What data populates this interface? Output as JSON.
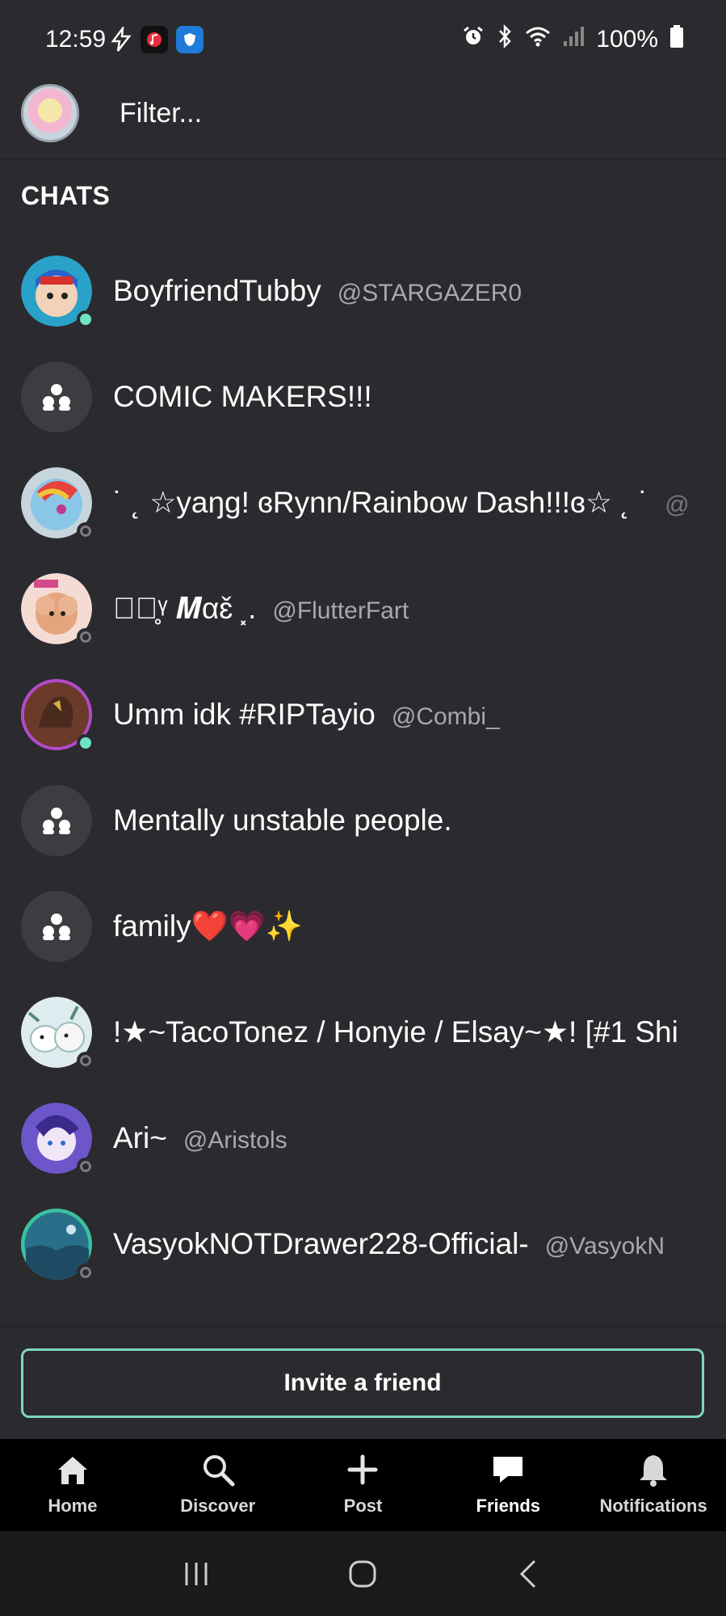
{
  "status_bar": {
    "time": "12:59",
    "battery": "100%",
    "app_icons": [
      "bolt-icon",
      "music-app-icon",
      "shield-app-icon"
    ],
    "system_icons": [
      "alarm-icon",
      "bluetooth-icon",
      "wifi-icon",
      "signal-icon",
      "battery-icon"
    ]
  },
  "header": {
    "filter_placeholder": "Filter..."
  },
  "chats": {
    "section_title": "CHATS",
    "items": [
      {
        "name": "BoyfriendTubby",
        "handle": "@STARGAZER0",
        "type": "user",
        "status": "online",
        "avatar_color": "#2aa1c9"
      },
      {
        "name": "COMIC MAKERS!!!",
        "handle": "",
        "type": "group",
        "status": "",
        "avatar_color": "#3d3c41"
      },
      {
        "name": "˙ ˛ ☆yaŋg! ɞRynn/Rainbow Dash!!!ɞ☆ ˛  ˙",
        "handle": "@",
        "type": "user",
        "status": "offline",
        "avatar_color": "#7fb8d8"
      },
      {
        "name": "⸼ꢂ̥ᵞ 𝑴αɛ̌ ⸼.",
        "handle": "@FlutterFart",
        "type": "user",
        "status": "offline",
        "avatar_color": "#e9b7a0"
      },
      {
        "name": "Umm idk #RIPTayio",
        "handle": "@Combi_",
        "type": "user",
        "status": "online",
        "avatar_color": "#8a5a3a"
      },
      {
        "name": "Mentally unstable people.",
        "handle": "",
        "type": "group",
        "status": "",
        "avatar_color": "#3d3c41"
      },
      {
        "name": "family❤️💗✨",
        "handle": "",
        "type": "group",
        "status": "",
        "avatar_color": "#3d3c41"
      },
      {
        "name": "!★~TacoTonez / Honyie / Elsay~★! [#1 Shi",
        "handle": "",
        "type": "user",
        "status": "offline",
        "avatar_color": "#cfe3ea"
      },
      {
        "name": "Ari~",
        "handle": "@Aristols",
        "type": "user",
        "status": "offline",
        "avatar_color": "#6c56c9"
      },
      {
        "name": "VasyokNOTDrawer228-Official-",
        "handle": "@VasyokN",
        "type": "user",
        "status": "offline",
        "avatar_color": "#2a6f8a"
      }
    ]
  },
  "invite": {
    "label": "Invite a friend"
  },
  "bottom_nav": {
    "items": [
      {
        "label": "Home",
        "icon": "home-icon"
      },
      {
        "label": "Discover",
        "icon": "search-icon"
      },
      {
        "label": "Post",
        "icon": "plus-icon"
      },
      {
        "label": "Friends",
        "icon": "chat-bubble-icon",
        "active": true
      },
      {
        "label": "Notifications",
        "icon": "bell-icon"
      }
    ]
  },
  "system_nav": {
    "buttons": [
      "recents-icon",
      "home-circle-icon",
      "back-icon"
    ]
  }
}
